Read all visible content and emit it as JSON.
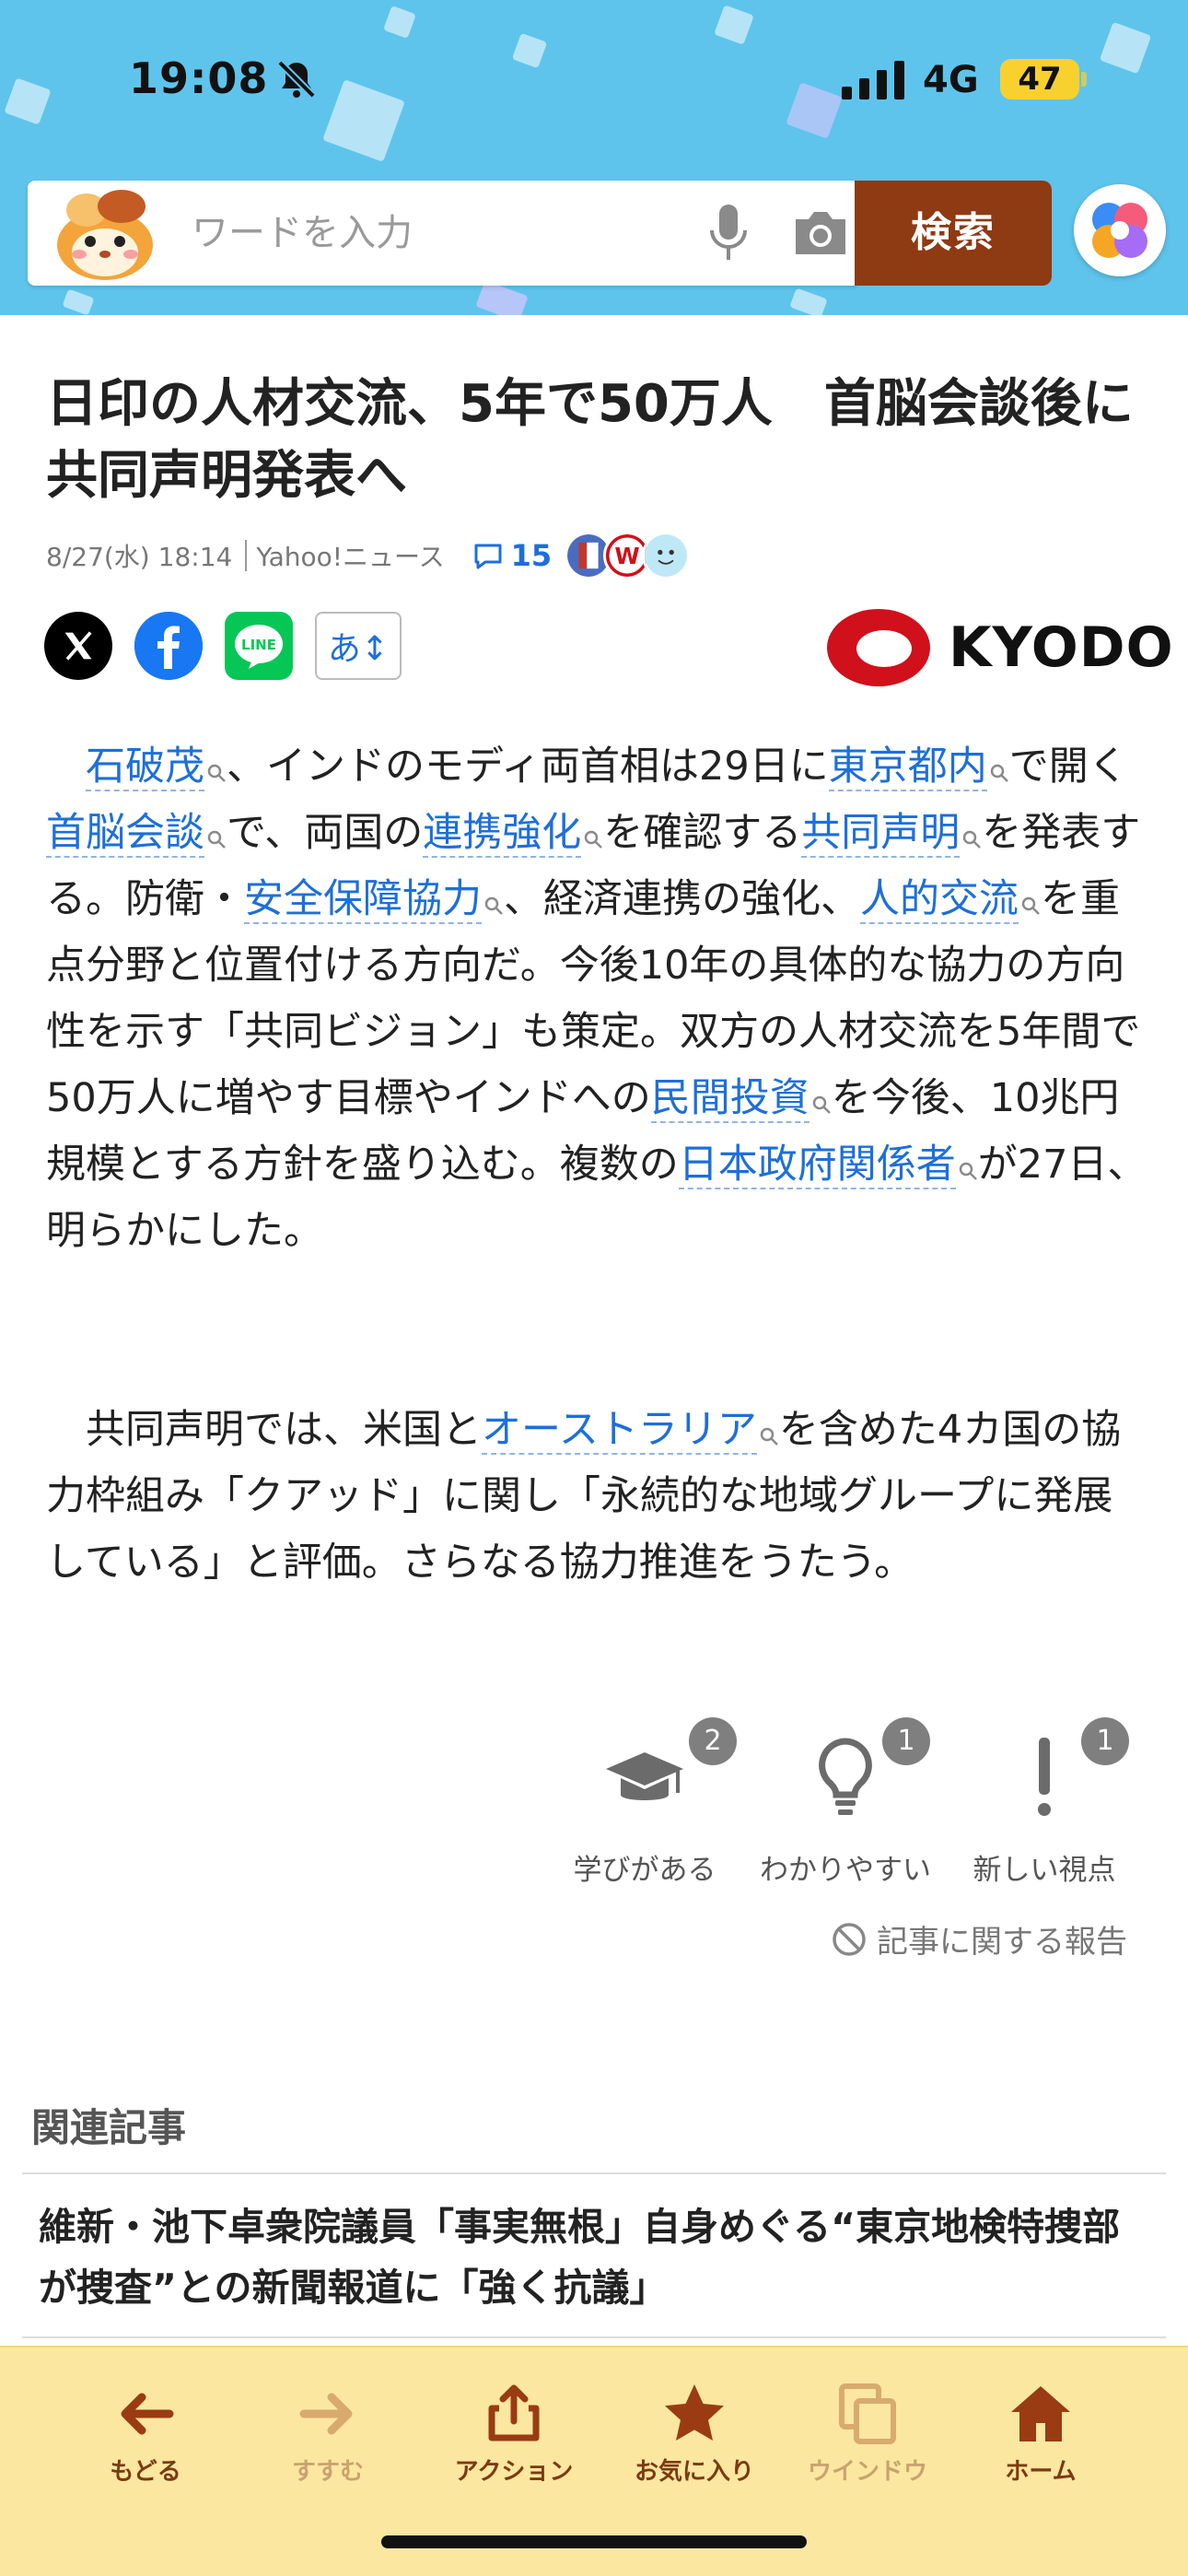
{
  "status_bar": {
    "time": "19:08",
    "network": "4G",
    "battery": "47"
  },
  "search": {
    "placeholder": "ワードを入力",
    "button_label": "検索"
  },
  "article": {
    "title": "日印の人材交流、5年で50万人　首脳会談後に共同声明発表へ",
    "datetime": "8/27(水) 18:14",
    "source": "Yahoo!ニュース",
    "comment_count": "15",
    "publisher_logo_text": "KYODO",
    "font_button_label": "あ↕",
    "paragraph1": [
      {
        "t": "　"
      },
      {
        "t": "石破茂",
        "kw": true
      },
      {
        "t": "、インドのモディ両首相は29日に"
      },
      {
        "t": "東京都内",
        "kw": true
      },
      {
        "t": "で開く"
      },
      {
        "t": "首脳会談",
        "kw": true
      },
      {
        "t": "で、両国の"
      },
      {
        "t": "連携強化",
        "kw": true
      },
      {
        "t": "を確認する"
      },
      {
        "t": "共同声明",
        "kw": true
      },
      {
        "t": "を発表する。防衛・"
      },
      {
        "t": "安全保障協力",
        "kw": true
      },
      {
        "t": "、経済連携の強化、"
      },
      {
        "t": "人的交流",
        "kw": true
      },
      {
        "t": "を重点分野と位置付ける方向だ。今後10年の具体的な協力の方向性を示す「共同ビジョン」も策定。双方の人材交流を5年間で50万人に増やす目標やインドへの"
      },
      {
        "t": "民間投資",
        "kw": true
      },
      {
        "t": "を今後、10兆円規模とする方針を盛り込む。複数の"
      },
      {
        "t": "日本政府関係者",
        "kw": true
      },
      {
        "t": "が27日、明らかにした。"
      }
    ],
    "paragraph2": [
      {
        "t": "　共同声明では、米国と"
      },
      {
        "t": "オーストラリア",
        "kw": true
      },
      {
        "t": "を含めた4カ国の協力枠組み「クアッド」に関し「永続的な地域グループに発展している」と評価。さらなる協力推進をうたう。"
      }
    ]
  },
  "reactions": [
    {
      "label": "学びがある",
      "count": "2",
      "icon": "graduation-cap-icon"
    },
    {
      "label": "わかりやすい",
      "count": "1",
      "icon": "lightbulb-icon"
    },
    {
      "label": "新しい視点",
      "count": "1",
      "icon": "exclamation-icon"
    }
  ],
  "report_label": "記事に関する報告",
  "related": {
    "heading": "関連記事",
    "items": [
      "維新・池下卓衆院議員「事実無根」自身めぐる“東京地検特捜部が捜査”との新聞報道に「強く抗議」"
    ]
  },
  "toolbar": {
    "back": "もどる",
    "forward": "すすむ",
    "action": "アクション",
    "favorites": "お気に入り",
    "window": "ウインドウ",
    "home": "ホーム"
  },
  "colors": {
    "header_bg": "#5ec4ec",
    "search_button": "#8e3a13",
    "link_blue": "#1e6fd9",
    "toolbar_bg": "#fbe7a0",
    "toolbar_text": "#7c3a12",
    "kyodo_red": "#d0101b"
  }
}
